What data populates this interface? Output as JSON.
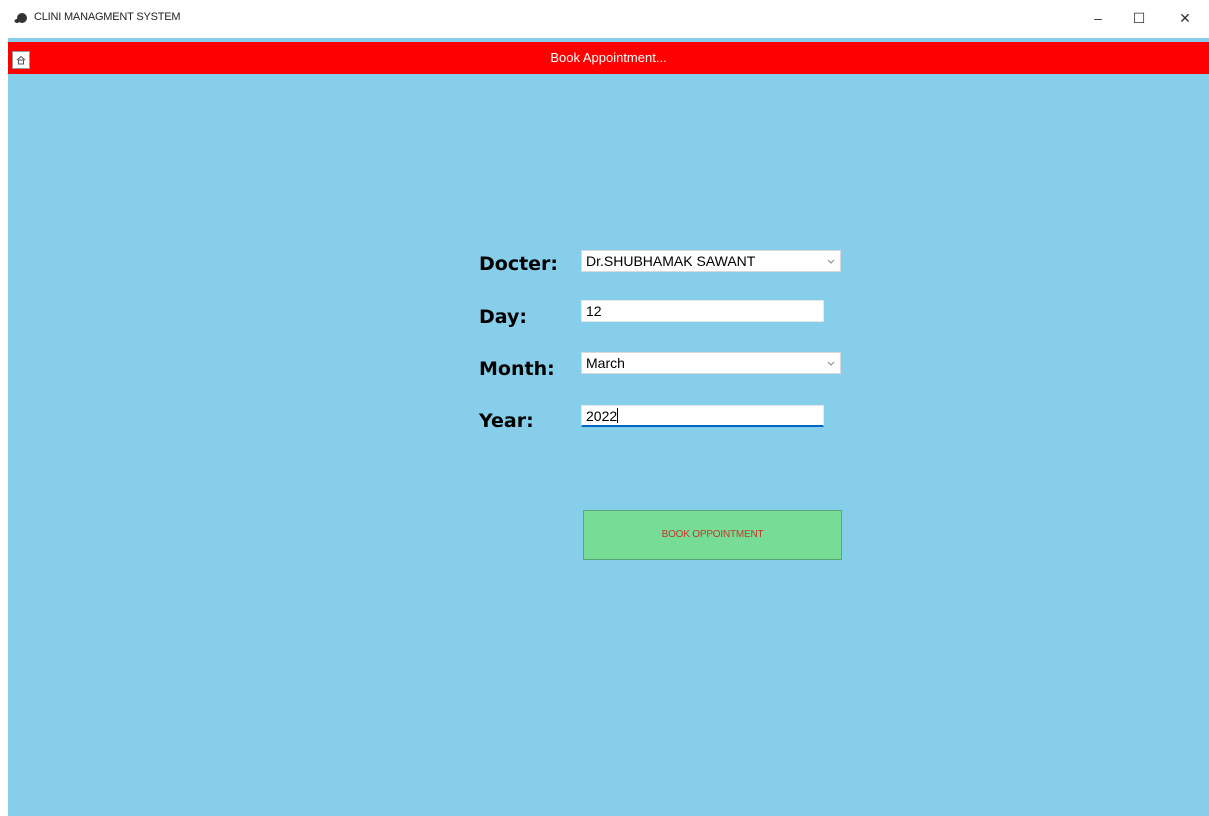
{
  "window": {
    "title": "CLINI MANAGMENT SYSTEM",
    "controls": {
      "minimize": "–",
      "maximize": "☐",
      "close": "✕"
    }
  },
  "header": {
    "title": "Book Appointment...",
    "home_icon": "home-icon",
    "bar_color": "#ff0000"
  },
  "form": {
    "background": "#87ceeb",
    "doctor": {
      "label": "Docter:",
      "value": "Dr.SHUBHAMAK SAWANT"
    },
    "day": {
      "label": "Day:",
      "value": "12"
    },
    "month": {
      "label": "Month:",
      "value": "March"
    },
    "year": {
      "label": "Year:",
      "value": "2022"
    },
    "submit_label": "BOOK OPPOINTMENT",
    "submit_color": "#77dd96"
  }
}
